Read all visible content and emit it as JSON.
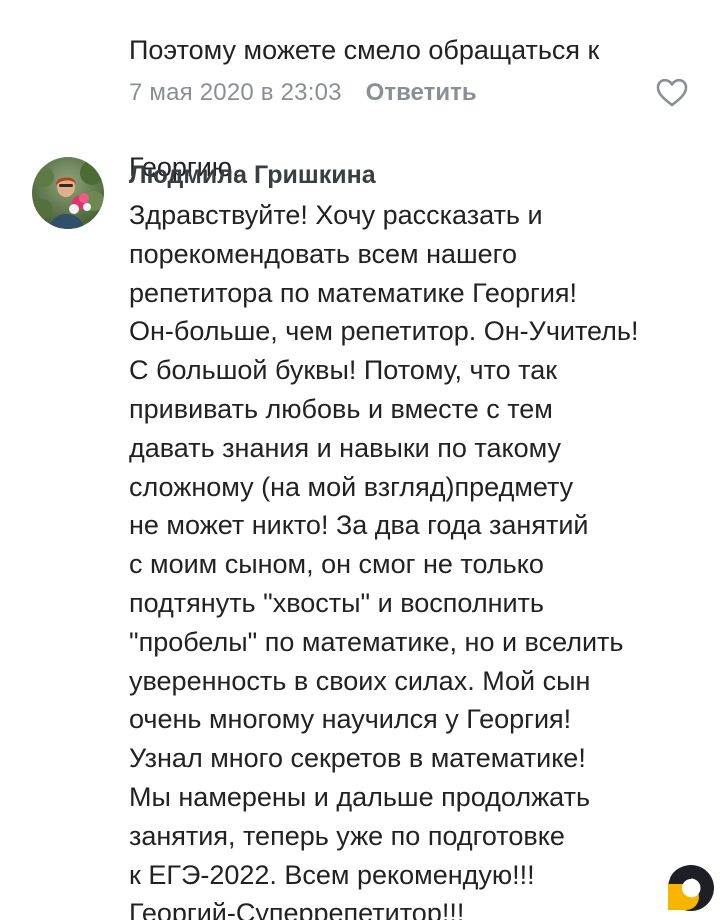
{
  "previous_comment": {
    "lines": [
      "Поэтому можете смело обращаться  к",
      "Георгию."
    ],
    "date": "7 мая 2020 в 23:03",
    "reply_label": "Ответить"
  },
  "comment": {
    "author": "Людмила Гришкина",
    "lines": [
      "Здравствуйте! Хочу рассказать и",
      "порекомендовать всем нашего",
      "репетитора по математике Георгия!",
      "Он-больше, чем репетитор. Он-Учитель!",
      "С большой буквы! Потому, что так",
      "прививать любовь и вместе с тем",
      "давать знания и навыки по такому",
      "сложному (на мой взгляд)предмету",
      "не может никто! За два года занятий",
      "с моим сыном, он смог не только",
      "подтянуть \"хвосты\" и восполнить",
      "\"пробелы\" по математике, но и вселить",
      "уверенность в своих силах. Мой сын",
      "очень многому научился у Георгия!",
      "Узнал много секретов в математике!",
      "Мы намерены и дальше продолжать",
      "занятия, теперь уже по подготовке",
      "к ЕГЭ-2022. Всем рекомендую!!!",
      "Георгий-Суперрепетитор!!!"
    ]
  },
  "icons": {
    "like": "heart-outline-icon",
    "brand": "brand-logo-icon"
  },
  "colors": {
    "text": "#222222",
    "meta": "#8a8f96",
    "author": "#3a3d42",
    "brand_yellow": "#f7b500",
    "brand_dark": "#1e1f24"
  }
}
